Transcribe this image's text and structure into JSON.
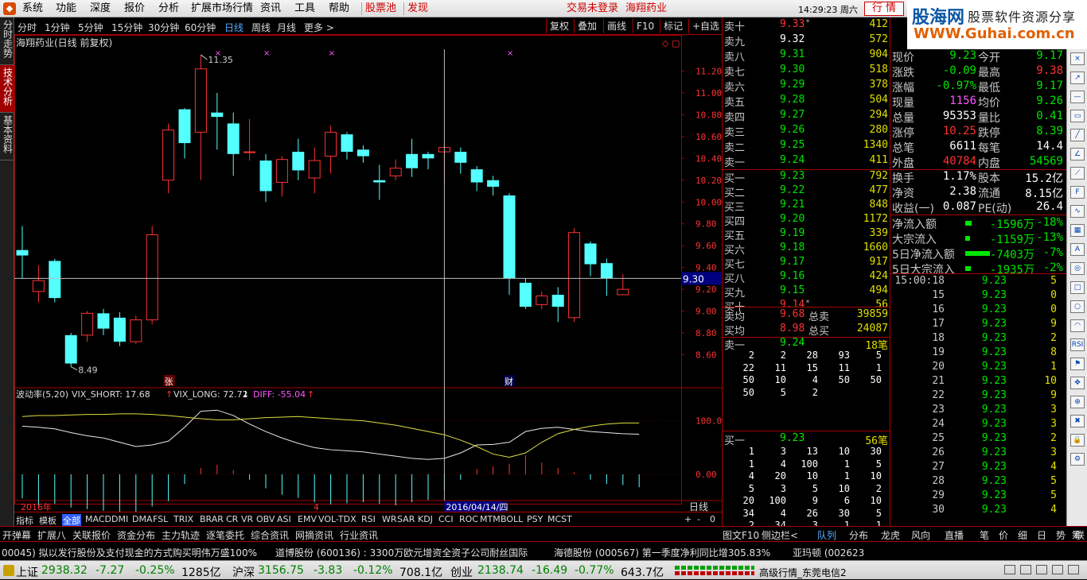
{
  "menu": {
    "items": [
      "系统",
      "功能",
      "深度",
      "报价",
      "分析",
      "扩展市场行情",
      "资讯",
      "工具",
      "帮助"
    ],
    "red_items": [
      "股票池",
      "发现"
    ],
    "login_status": "交易未登录",
    "stock_name": "海翔药业",
    "clock": "14:29:23 周六",
    "market_tab": "行  情"
  },
  "brand": {
    "site_cn": "股海网",
    "slogan": "股票软件资源分享",
    "url": "WWW.Guhai.com.cn"
  },
  "left_tabs": [
    "分时走势",
    "技术分析",
    "基本资料"
  ],
  "periods": [
    "分时",
    "1分钟",
    "5分钟",
    "15分钟",
    "30分钟",
    "60分钟",
    "日线",
    "周线",
    "月线",
    "更多 >"
  ],
  "active_period": "日线",
  "toolbar": [
    "复权",
    "叠加",
    "画线",
    "F10",
    "标记",
    "+自选"
  ],
  "chart_title": "海翔药业(日线 前复权)",
  "colors": {
    "up": "#ff3232",
    "down": "#54ffff",
    "grid": "#a00000"
  },
  "chart_data": {
    "type": "candlestick",
    "y_axis": {
      "min": 8.4,
      "max": 11.4,
      "ticks": [
        "11.20",
        "11.00",
        "10.80",
        "10.60",
        "10.40",
        "10.20",
        "10.00",
        "9.80",
        "9.60",
        "9.40",
        "9.20",
        "9.00",
        "8.80",
        "8.60"
      ]
    },
    "high_label": "11.35",
    "low_label": "8.49",
    "crosshair_price": "9.30",
    "candles": [
      {
        "o": 9.56,
        "c": 9.51,
        "h": 9.78,
        "l": 9.3
      },
      {
        "o": 9.18,
        "c": 9.28,
        "h": 9.42,
        "l": 9.08
      },
      {
        "o": 9.46,
        "c": 9.12,
        "h": 9.48,
        "l": 9.08
      },
      {
        "o": 8.78,
        "c": 8.52,
        "h": 8.8,
        "l": 8.49
      },
      {
        "o": 8.78,
        "c": 8.98,
        "h": 9.0,
        "l": 8.72
      },
      {
        "o": 8.98,
        "c": 8.84,
        "h": 9.02,
        "l": 8.78
      },
      {
        "o": 8.94,
        "c": 8.72,
        "h": 8.99,
        "l": 8.68
      },
      {
        "o": 8.72,
        "c": 8.92,
        "h": 8.96,
        "l": 8.7
      },
      {
        "o": 8.92,
        "c": 9.7,
        "h": 9.78,
        "l": 8.88
      },
      {
        "o": 10.2,
        "c": 10.66,
        "h": 10.72,
        "l": 10.08
      },
      {
        "o": 10.85,
        "c": 10.54,
        "h": 10.86,
        "l": 10.4
      },
      {
        "o": 10.64,
        "c": 11.22,
        "h": 11.35,
        "l": 10.2
      },
      {
        "o": 10.82,
        "c": 10.78,
        "h": 11.0,
        "l": 10.48
      },
      {
        "o": 10.72,
        "c": 10.44,
        "h": 10.82,
        "l": 10.24
      },
      {
        "o": 10.46,
        "c": 10.46,
        "h": 10.76,
        "l": 10.38
      },
      {
        "o": 10.38,
        "c": 10.1,
        "h": 10.44,
        "l": 10.0
      },
      {
        "o": 10.18,
        "c": 10.39,
        "h": 10.42,
        "l": 10.05
      },
      {
        "o": 10.46,
        "c": 10.29,
        "h": 10.58,
        "l": 10.2
      },
      {
        "o": 10.22,
        "c": 10.38,
        "h": 10.5,
        "l": 10.08
      },
      {
        "o": 10.42,
        "c": 10.64,
        "h": 10.7,
        "l": 10.26
      },
      {
        "o": 10.62,
        "c": 10.46,
        "h": 10.64,
        "l": 10.39
      },
      {
        "o": 10.48,
        "c": 10.42,
        "h": 10.52,
        "l": 10.36
      },
      {
        "o": 10.2,
        "c": 10.18,
        "h": 10.34,
        "l": 10.02
      },
      {
        "o": 10.24,
        "c": 10.31,
        "h": 10.39,
        "l": 10.2
      },
      {
        "o": 10.44,
        "c": 10.31,
        "h": 10.58,
        "l": 10.23
      },
      {
        "o": 10.44,
        "c": 10.4,
        "h": 10.46,
        "l": 10.3
      },
      {
        "o": 10.46,
        "c": 10.5,
        "h": 10.54,
        "l": 10.18
      },
      {
        "o": 10.46,
        "c": 10.36,
        "h": 10.5,
        "l": 10.26
      },
      {
        "o": 10.3,
        "c": 10.18,
        "h": 10.33,
        "l": 10.1
      },
      {
        "o": 10.2,
        "c": 10.14,
        "h": 10.24,
        "l": 10.06
      },
      {
        "o": 10.06,
        "c": 9.3,
        "h": 10.08,
        "l": 9.15
      },
      {
        "o": 9.26,
        "c": 9.04,
        "h": 9.3,
        "l": 9.02
      },
      {
        "o": 9.06,
        "c": 9.14,
        "h": 9.18,
        "l": 9.02
      },
      {
        "o": 9.15,
        "c": 9.04,
        "h": 9.22,
        "l": 8.9
      },
      {
        "o": 8.94,
        "c": 9.72,
        "h": 9.76,
        "l": 8.9
      },
      {
        "o": 9.62,
        "c": 9.43,
        "h": 9.64,
        "l": 9.32
      },
      {
        "o": 9.44,
        "c": 9.3,
        "h": 9.48,
        "l": 9.14
      },
      {
        "o": 9.15,
        "c": 9.2,
        "h": 9.34,
        "l": 9.15
      }
    ]
  },
  "markers": {
    "zhang": "张",
    "cai": "财"
  },
  "indicator": {
    "name": "波动率(5,20)",
    "short_label": "VIX_SHORT: 17.68",
    "long_label": "VIX_LONG: 72.72",
    "diff_label": "DIFF: -55.04",
    "y_ticks": [
      "100.0",
      "0.00"
    ],
    "min": -40,
    "max": 150,
    "short_series": [
      90,
      88,
      85,
      78,
      72,
      68,
      60,
      52,
      55,
      62,
      88,
      118,
      120,
      110,
      94,
      80,
      68,
      58,
      50,
      46,
      44,
      42,
      38,
      34,
      30,
      28,
      30,
      40,
      55,
      56,
      60,
      80,
      86,
      88,
      84,
      80,
      78,
      76,
      75
    ],
    "long_series": [
      108,
      110,
      110,
      111,
      112,
      112,
      113,
      113,
      112,
      110,
      107,
      104,
      102,
      102,
      104,
      106,
      107,
      108,
      106,
      104,
      102,
      100,
      96,
      92,
      86,
      80,
      74,
      64,
      52,
      38,
      32,
      40,
      60,
      76,
      84,
      90,
      94,
      96,
      96
    ],
    "bars": [
      -45,
      -58,
      -55,
      -62,
      -65,
      -68,
      -70,
      -72,
      -60,
      -50,
      -18,
      12,
      18,
      8,
      -10,
      -26,
      -38,
      -44,
      -52,
      -56,
      -54,
      -52,
      -55,
      -58,
      -52,
      -48,
      -30,
      -10,
      10,
      15,
      20,
      36,
      22,
      12,
      4,
      -10,
      -18,
      -20,
      -24
    ]
  },
  "x_labels": {
    "start": "2016年",
    "mid": "4",
    "current": "2016/04/14/四",
    "period": "日线"
  },
  "bottom_tabs": [
    "指标",
    "模板",
    "全部",
    "MACD",
    "DMI",
    "DMA",
    "FSL",
    "TRIX",
    "BRAR",
    "CR",
    "VR",
    "OBV",
    "ASI",
    "EMV",
    "VOL-TDX",
    "RSI",
    "WR",
    "SAR",
    "KDJ",
    "CCI",
    "ROC",
    "MTM",
    "BOLL",
    "PSY",
    "MCST"
  ],
  "active_bottom_tab": "全部",
  "chart_ctrls": [
    "+",
    "-",
    "0"
  ],
  "order_book": {
    "sells": [
      {
        "label": "卖十",
        "price": "9.33",
        "vol": "412",
        "mark": "*"
      },
      {
        "label": "卖九",
        "price": "9.32",
        "vol": "572",
        "mark": ""
      },
      {
        "label": "卖八",
        "price": "9.31",
        "vol": "904",
        "mark": ""
      },
      {
        "label": "卖七",
        "price": "9.30",
        "vol": "518",
        "mark": ""
      },
      {
        "label": "卖六",
        "price": "9.29",
        "vol": "378",
        "mark": ""
      },
      {
        "label": "卖五",
        "price": "9.28",
        "vol": "504",
        "mark": ""
      },
      {
        "label": "卖四",
        "price": "9.27",
        "vol": "294",
        "mark": ""
      },
      {
        "label": "卖三",
        "price": "9.26",
        "vol": "280",
        "mark": ""
      },
      {
        "label": "卖二",
        "price": "9.25",
        "vol": "1340",
        "mark": ""
      },
      {
        "label": "卖一",
        "price": "9.24",
        "vol": "411",
        "mark": ""
      }
    ],
    "buys": [
      {
        "label": "买一",
        "price": "9.23",
        "vol": "792",
        "mark": ""
      },
      {
        "label": "买二",
        "price": "9.22",
        "vol": "477",
        "mark": ""
      },
      {
        "label": "买三",
        "price": "9.21",
        "vol": "848",
        "mark": ""
      },
      {
        "label": "买四",
        "price": "9.20",
        "vol": "1172",
        "mark": ""
      },
      {
        "label": "买五",
        "price": "9.19",
        "vol": "339",
        "mark": ""
      },
      {
        "label": "买六",
        "price": "9.18",
        "vol": "1660",
        "mark": ""
      },
      {
        "label": "买七",
        "price": "9.17",
        "vol": "917",
        "mark": ""
      },
      {
        "label": "买八",
        "price": "9.16",
        "vol": "424",
        "mark": ""
      },
      {
        "label": "买九",
        "price": "9.15",
        "vol": "494",
        "mark": ""
      },
      {
        "label": "买十",
        "price": "9.14",
        "vol": "56",
        "mark": "*"
      }
    ],
    "avg_sell": {
      "label": "卖均",
      "price": "9.68",
      "label2": "总卖",
      "vol": "39859"
    },
    "avg_buy": {
      "label": "买均",
      "price": "8.98",
      "label2": "总买",
      "vol": "24087"
    },
    "sell1_queue": {
      "label": "卖一",
      "price": "9.24",
      "count": "18笔",
      "rows": [
        [
          "2",
          "2",
          "28",
          "93",
          "5"
        ],
        [
          "22",
          "11",
          "15",
          "11",
          "1"
        ],
        [
          "50",
          "10",
          "4",
          "50",
          "50"
        ],
        [
          "50",
          "5",
          "2",
          "",
          ""
        ]
      ]
    },
    "buy1_queue": {
      "label": "买一",
      "price": "9.23",
      "count": "56笔",
      "rows": [
        [
          "1",
          "3",
          "13",
          "10",
          "30"
        ],
        [
          "1",
          "4",
          "100",
          "1",
          "5"
        ],
        [
          "4",
          "20",
          "10",
          "1",
          "10"
        ],
        [
          "5",
          "3",
          "5",
          "10",
          "2"
        ],
        [
          "20",
          "100",
          "9",
          "6",
          "10"
        ],
        [
          "34",
          "4",
          "26",
          "30",
          "5"
        ],
        [
          "2",
          "34",
          "3",
          "1",
          "1"
        ]
      ]
    }
  },
  "info": {
    "rows": [
      {
        "a": "现价",
        "av": "9.23",
        "ac": "dn",
        "b": "今开",
        "bv": "9.17",
        "bc": "dn"
      },
      {
        "a": "涨跌",
        "av": "-0.09",
        "ac": "dn",
        "b": "最高",
        "bv": "9.38",
        "bc": "up"
      },
      {
        "a": "涨幅",
        "av": "-0.97%",
        "ac": "dn",
        "b": "最低",
        "bv": "9.17",
        "bc": "dn"
      },
      {
        "a": "现量",
        "av": "1156",
        "ac": "mg",
        "b": "均价",
        "bv": "9.26",
        "bc": "dn"
      },
      {
        "a": "总量",
        "av": "95353",
        "ac": "wh",
        "b": "量比",
        "bv": "0.41",
        "bc": "dn"
      },
      {
        "a": "涨停",
        "av": "10.25",
        "ac": "up",
        "b": "跌停",
        "bv": "8.39",
        "bc": "dn"
      },
      {
        "a": "总笔",
        "av": "6611",
        "ac": "wh",
        "b": "每笔",
        "bv": "14.4",
        "bc": "wh"
      },
      {
        "a": "外盘",
        "av": "40784",
        "ac": "up",
        "b": "内盘",
        "bv": "54569",
        "bc": "dn"
      },
      {
        "a": "换手",
        "av": "1.17%",
        "ac": "wh",
        "b": "股本",
        "bv": "15.2亿",
        "bc": "wh"
      },
      {
        "a": "净资",
        "av": "2.38",
        "ac": "wh",
        "b": "流通",
        "bv": "8.15亿",
        "bc": "wh"
      },
      {
        "a": "收益(一)",
        "av": "0.087",
        "ac": "wh",
        "b": "PE(动)",
        "bv": "26.4",
        "bc": "wh"
      }
    ],
    "flows": [
      {
        "label": "净流入额",
        "value": "-1596万",
        "pct": "-18%",
        "bar": 0.12
      },
      {
        "label": "大宗流入",
        "value": "-1159万",
        "pct": "-13%",
        "bar": 0.08
      },
      {
        "label": "5日净流入额",
        "value": "-7403万",
        "pct": "-7%",
        "bar": 0.9
      },
      {
        "label": "5日大宗流入",
        "value": "-1935万",
        "pct": "-2%",
        "bar": 0.1
      }
    ]
  },
  "ticks": [
    {
      "t": "15:00:18",
      "p": "9.23",
      "v": "5"
    },
    {
      "t": "15",
      "p": "9.23",
      "v": "0"
    },
    {
      "t": "16",
      "p": "9.23",
      "v": "0"
    },
    {
      "t": "17",
      "p": "9.23",
      "v": "9"
    },
    {
      "t": "18",
      "p": "9.23",
      "v": "2"
    },
    {
      "t": "19",
      "p": "9.23",
      "v": "8"
    },
    {
      "t": "20",
      "p": "9.23",
      "v": "1"
    },
    {
      "t": "21",
      "p": "9.23",
      "v": "10"
    },
    {
      "t": "22",
      "p": "9.23",
      "v": "9"
    },
    {
      "t": "23",
      "p": "9.23",
      "v": "3"
    },
    {
      "t": "24",
      "p": "9.23",
      "v": "3"
    },
    {
      "t": "25",
      "p": "9.23",
      "v": "2"
    },
    {
      "t": "26",
      "p": "9.23",
      "v": "3"
    },
    {
      "t": "27",
      "p": "9.23",
      "v": "4"
    },
    {
      "t": "28",
      "p": "9.23",
      "v": "5"
    },
    {
      "t": "29",
      "p": "9.23",
      "v": "5"
    },
    {
      "t": "30",
      "p": "9.23",
      "v": "4"
    }
  ],
  "right_tabs": [
    "图文F10",
    "侧边栏<",
    "队列",
    "分布",
    "龙虎",
    "风向",
    "直播",
    "笔",
    "价",
    "细",
    "日",
    "势",
    "联",
    "值",
    "筹"
  ],
  "function_bar": [
    "开弹幕",
    "扩展八",
    "关联报价",
    "资金分布",
    "主力轨迹",
    "逐笔委托",
    "综合资讯",
    "网摘资讯",
    "行业资讯"
  ],
  "news": [
    "00045) 拟以发行股份及支付现金的方式购买明伟万盛100%",
    "道博股份 (600136) : 3300万欧元增资全资子公司耐丝国际",
    "海德股份 (000567) 第一季度净利同比增305.83%",
    "亚玛顿 (002623"
  ],
  "status": {
    "sh_label": "上证",
    "sh_val": "2938.32",
    "sh_chg": "-7.27",
    "sh_pct": "-0.25%",
    "sh_amt": "1285亿",
    "hs_label": "沪深",
    "hs_val": "3156.75",
    "hs_chg": "-3.83",
    "hs_pct": "-0.12%",
    "hs_amt": "708.1亿",
    "cy_label": "创业",
    "cy_val": "2138.74",
    "cy_chg": "-16.49",
    "cy_pct": "-0.77%",
    "cy_amt": "643.7亿",
    "server": "高级行情_东莞电信2"
  },
  "right_tool_icons": [
    "close-icon",
    "arrow-icon",
    "minus-icon",
    "restore-icon",
    "line-icon",
    "angle-icon",
    "trend-icon",
    "fib-icon",
    "wave-icon",
    "grid-icon",
    "text-icon",
    "cycle-icon",
    "rect-icon",
    "circle-icon",
    "arc-icon",
    "rsi-icon",
    "flag-icon",
    "move-icon",
    "zoom-icon",
    "delete-icon",
    "lock-icon",
    "settings-icon"
  ]
}
